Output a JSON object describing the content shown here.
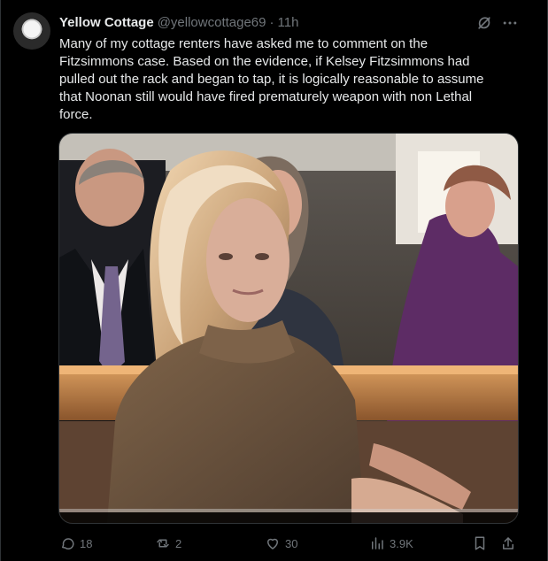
{
  "tweet": {
    "author": {
      "display_name": "Yellow Cottage",
      "handle": "@yellowcottage69",
      "separator": "·",
      "timestamp": "11h"
    },
    "text": "Many of my cottage renters have asked me to comment on the Fitzsimmons case. Based on the evidence, if Kelsey Fitzsimmons had pulled out the rack and began to tap, it is logically reasonable to assume that Noonan still would have fired prematurely weapon with non Lethal force.",
    "media": {
      "kind": "photo"
    },
    "actions": {
      "replies": "18",
      "reposts": "2",
      "likes": "30",
      "views": "3.9K"
    },
    "icons": {
      "avatar": "avatar",
      "grok": "grok-icon",
      "more": "more-icon",
      "reply": "reply-icon",
      "repost": "repost-icon",
      "like": "heart-icon",
      "views": "views-icon",
      "bookmark": "bookmark-icon",
      "share": "share-icon"
    },
    "colors": {
      "background": "#000000",
      "primary_text": "#e7e9ea",
      "secondary_text": "#71767b",
      "border": "#2f3336"
    }
  }
}
